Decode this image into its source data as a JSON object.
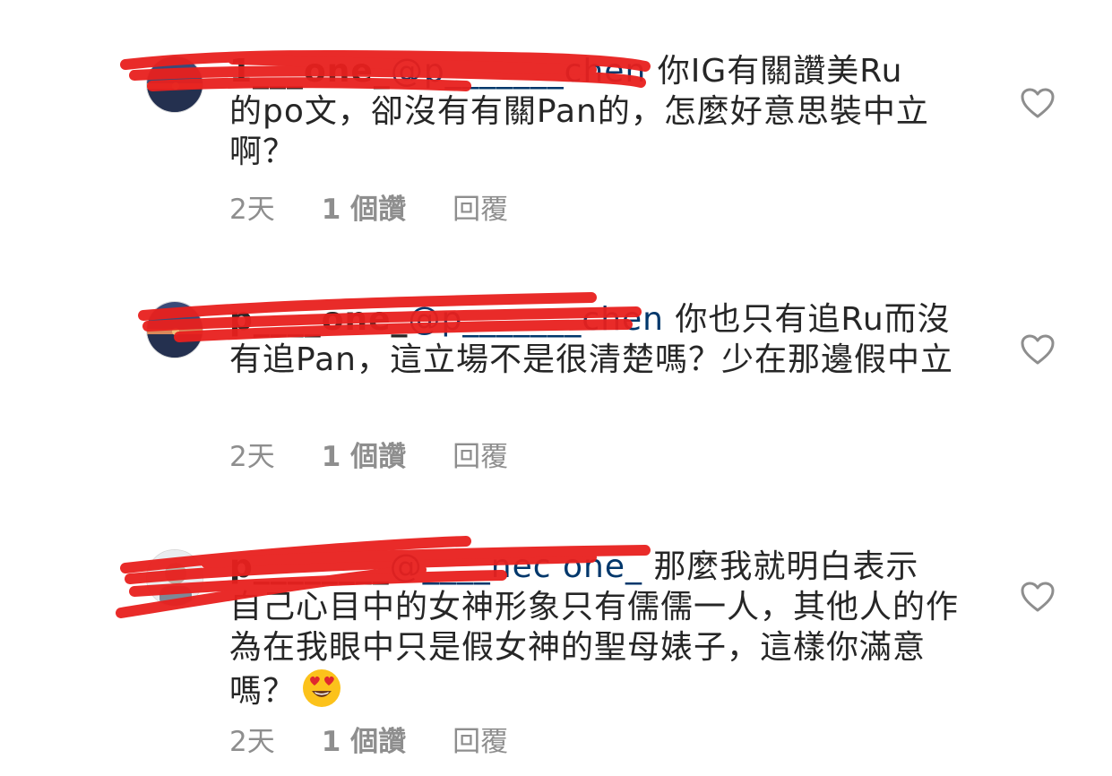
{
  "colors": {
    "text": "#262626",
    "meta": "#8e8e8e",
    "mention": "#00376b",
    "redaction": "#e8201e"
  },
  "comments": [
    {
      "username": "1___one_",
      "mention": "@p_______chen",
      "text_line1": " 你IG有關讚美Ru",
      "text_rest": "的po文，卻沒有有關Pan的，怎麼好意思裝中立啊？",
      "time": "2天",
      "likes": "1 個讚",
      "reply": "回覆",
      "heart_icon": "heart-outline-icon"
    },
    {
      "username": "p____one_",
      "mention": "@p_______chen",
      "text_line1": " 你也只有追Ru而沒",
      "text_rest": "有追Pan，這立場不是很清楚嗎？少在那邊假中立",
      "time": "2天",
      "likes": "1 個讚",
      "reply": "回覆",
      "heart_icon": "heart-outline-icon"
    },
    {
      "username": "p________",
      "mention": "@____nec one_",
      "text_line1": " 那麼我就明白表示",
      "text_rest": "自己心目中的女神形象只有儒儒一人，其他人的作為在我眼中只是假女神的聖母婊子，這樣你滿意嗎？",
      "emoji": "heart-eyes-emoji",
      "time": "2天",
      "likes": "1 個讚",
      "reply": "回覆",
      "heart_icon": "heart-outline-icon"
    }
  ]
}
